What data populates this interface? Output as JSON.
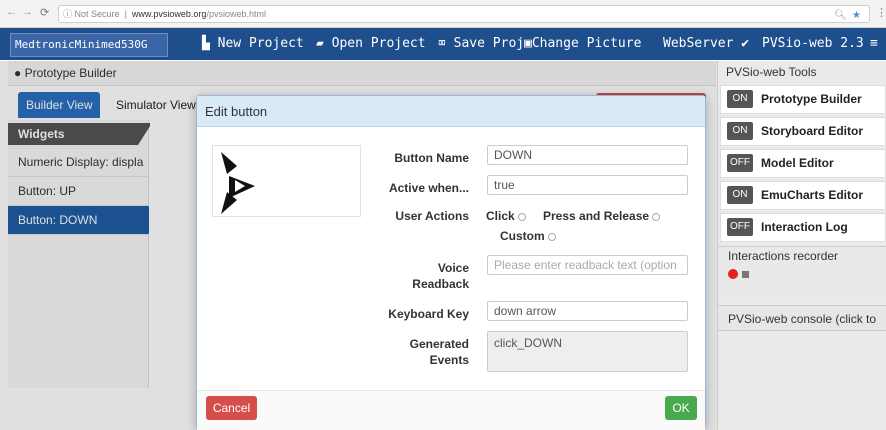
{
  "browser": {
    "security": "Not Secure",
    "url_host": "www.pvsioweb.org",
    "url_path": "/pvsioweb.html"
  },
  "navbar": {
    "brand": "MedtronicMinimed530G",
    "new_project": "New Project",
    "open_project": "Open Project",
    "save_project": "Save Proj",
    "change_picture": "Change Picture",
    "webserver": "WebServer",
    "pvsio_version": "PVSio-web 2.3"
  },
  "builder": {
    "header": "Prototype Builder",
    "tabs": [
      "Builder View",
      "Simulator View"
    ],
    "widgets_title": "Widgets",
    "widgets": [
      {
        "label": "Numeric Display: displa",
        "selected": false
      },
      {
        "label": "Button: UP",
        "selected": false
      },
      {
        "label": "Button: DOWN",
        "selected": true
      }
    ]
  },
  "tools": {
    "title": "PVSio-web Tools",
    "items": [
      {
        "label": "Prototype Builder",
        "toggle": "ON"
      },
      {
        "label": "Storyboard Editor",
        "toggle": "ON"
      },
      {
        "label": "Model Editor",
        "toggle": "OFF"
      },
      {
        "label": "EmuCharts Editor",
        "toggle": "ON"
      },
      {
        "label": "Interaction Log",
        "toggle": "OFF"
      }
    ],
    "recorder_title": "Interactions recorder",
    "console_title": "PVSio-web console (click to"
  },
  "dialog": {
    "title": "Edit button",
    "button_name_label": "Button Name",
    "button_name_value": "DOWN",
    "active_when_label": "Active when...",
    "active_when_value": "true",
    "user_actions_label": "User Actions",
    "action_click": "Click",
    "action_press_release": "Press and Release",
    "action_custom": "Custom",
    "voice_label_1": "Voice",
    "voice_label_2": "Readback",
    "voice_placeholder": "Please enter readback text (option",
    "keyboard_label": "Keyboard Key",
    "keyboard_value": "down arrow",
    "generated_label_1": "Generated",
    "generated_label_2": "Events",
    "generated_value": "click_DOWN",
    "cancel": "Cancel",
    "ok": "OK"
  },
  "colors": {
    "navbar": "#1e4e8c",
    "selected": "#1f5da6",
    "cancel": "#d64e4b",
    "ok": "#48a94d",
    "dialog_header": "#d9eaf7"
  }
}
